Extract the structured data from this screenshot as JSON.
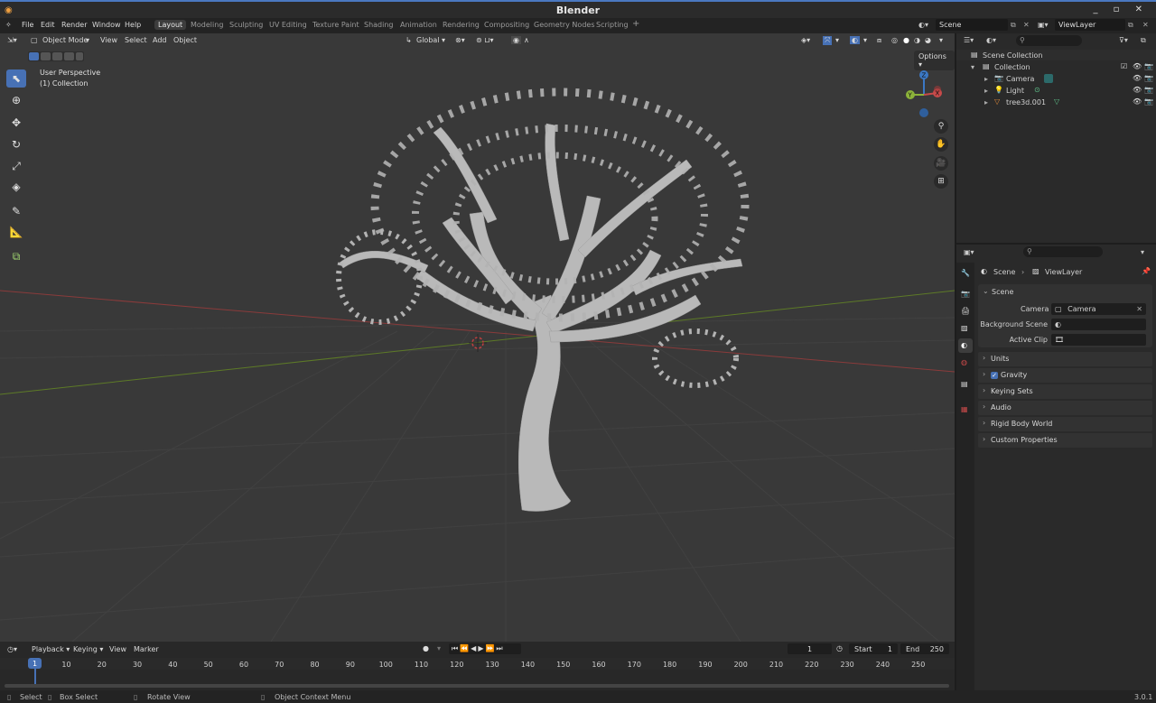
{
  "window": {
    "title": "Blender",
    "controls": "_ ▫ ✕"
  },
  "menu": [
    "File",
    "Edit",
    "Render",
    "Window",
    "Help"
  ],
  "workspaces": [
    "Layout",
    "Modeling",
    "Sculpting",
    "UV Editing",
    "Texture Paint",
    "Shading",
    "Animation",
    "Rendering",
    "Compositing",
    "Geometry Nodes",
    "Scripting"
  ],
  "active_workspace": "Layout",
  "scene_name": "Scene",
  "view_layer": "ViewLayer",
  "viewport": {
    "mode": "Object Mode",
    "menus": [
      "View",
      "Select",
      "Add",
      "Object"
    ],
    "orientation": "Global",
    "overlay_title": "User Perspective",
    "overlay_collection": "(1) Collection",
    "options_label": "Options",
    "gizmo_axes": {
      "x": "X",
      "y": "Y",
      "z": "Z"
    },
    "colors": {
      "background": "#393939",
      "tree": "#b9b9b9",
      "x_axis": "#b04848",
      "y_axis": "#6f8d2e",
      "selected_tool": "#4771b5"
    }
  },
  "outliner": {
    "root": "Scene Collection",
    "collection": "Collection",
    "items": [
      {
        "name": "Camera",
        "icon": "camera-icon"
      },
      {
        "name": "Light",
        "icon": "light-icon"
      },
      {
        "name": "tree3d.001",
        "icon": "mesh-icon"
      }
    ]
  },
  "properties": {
    "breadcrumb_scene": "Scene",
    "breadcrumb_layer": "ViewLayer",
    "section_scene": "Scene",
    "camera_label": "Camera",
    "camera_value": "Camera",
    "background_scene_label": "Background Scene",
    "active_clip_label": "Active Clip",
    "sections": [
      "Units",
      "Gravity",
      "Keying Sets",
      "Audio",
      "Rigid Body World",
      "Custom Properties"
    ],
    "gravity_checked": true
  },
  "timeline": {
    "menus": [
      "Playback",
      "Keying",
      "View",
      "Marker"
    ],
    "current_frame": "1",
    "start_label": "Start",
    "start": "1",
    "end_label": "End",
    "end": "250",
    "ticks": [
      "10",
      "20",
      "30",
      "40",
      "50",
      "60",
      "70",
      "80",
      "90",
      "100",
      "110",
      "120",
      "130",
      "140",
      "150",
      "160",
      "170",
      "180",
      "190",
      "200",
      "210",
      "220",
      "230",
      "240",
      "250"
    ],
    "playhead": "1"
  },
  "status": {
    "select": "Select",
    "box_select": "Box Select",
    "rotate_view": "Rotate View",
    "context_menu": "Object Context Menu",
    "version": "3.0.1"
  }
}
